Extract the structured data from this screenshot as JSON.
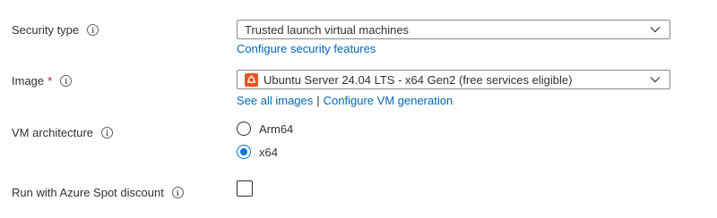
{
  "security_type": {
    "label": "Security type",
    "info_icon": "info-icon",
    "value": "Trusted launch virtual machines",
    "link": "Configure security features"
  },
  "image": {
    "label": "Image",
    "required_mark": "*",
    "info_icon": "info-icon",
    "logo_icon": "ubuntu-logo-icon",
    "value": "Ubuntu Server 24.04 LTS - x64 Gen2 (free services eligible)",
    "link_all_images": "See all images",
    "separator": "|",
    "link_configure_vm": "Configure VM generation"
  },
  "vm_architecture": {
    "label": "VM architecture",
    "info_icon": "info-icon",
    "options": [
      {
        "label": "Arm64",
        "selected": false
      },
      {
        "label": "x64",
        "selected": true
      }
    ]
  },
  "spot_discount": {
    "label": "Run with Azure Spot discount",
    "info_icon": "info-icon",
    "checked": false
  },
  "colors": {
    "link": "#0067b8",
    "accent": "#0078d4",
    "required": "#a4262c",
    "ubuntu": "#e95420"
  }
}
